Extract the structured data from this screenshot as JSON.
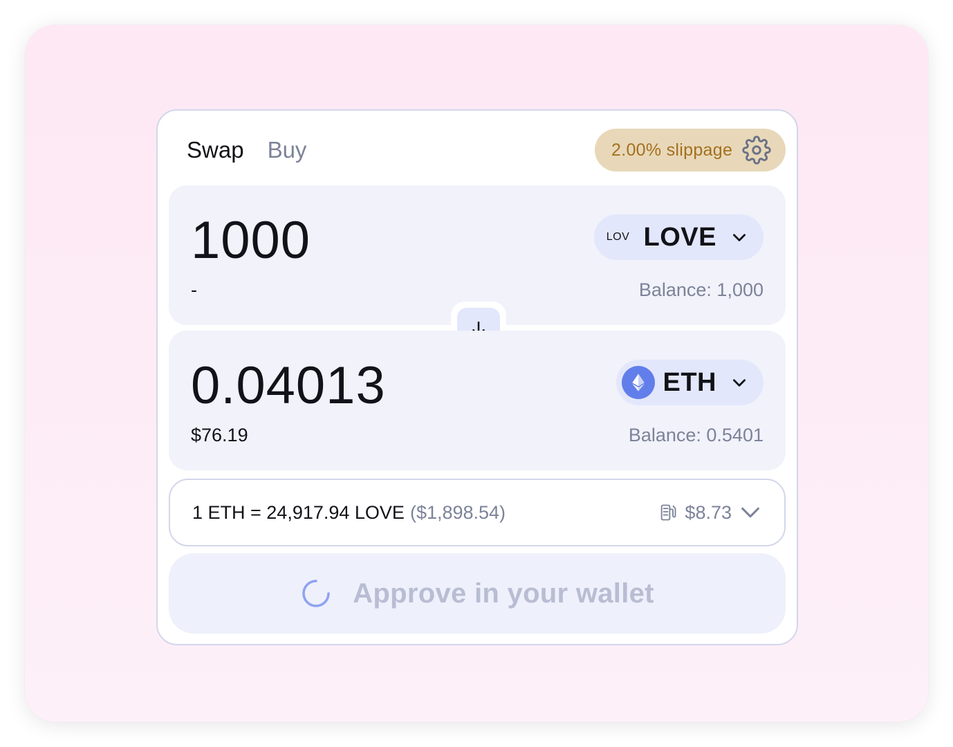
{
  "tabs": [
    {
      "label": "Swap",
      "active": true
    },
    {
      "label": "Buy",
      "active": false
    }
  ],
  "slippage": {
    "label": "2.00% slippage",
    "icon": "gear-icon"
  },
  "input": {
    "amount": "1000",
    "usd_value": "-",
    "token": {
      "badge": "LOV",
      "symbol": "LOVE"
    },
    "balance": "Balance: 1,000"
  },
  "output": {
    "amount": "0.04013",
    "usd_value": "$76.19",
    "token": {
      "symbol": "ETH",
      "icon": "eth-logo-icon"
    },
    "balance": "Balance: 0.5401"
  },
  "rate": {
    "text": "1 ETH = 24,917.94 LOVE",
    "usd": "($1,898.54)",
    "gas_fee": "$8.73",
    "gas_icon": "gas-pump-icon"
  },
  "approve": {
    "label": "Approve in your wallet",
    "icon": "spinner-icon"
  },
  "colors": {
    "background": "#fde8f4",
    "slippage_bg": "#e8d8b9",
    "slippage_text": "#a3701e",
    "panel_bg": "#f1f2fa",
    "token_pill": "#e3e7fb",
    "muted_text": "#7c8399",
    "eth_brand": "#627eea",
    "approve_text": "#b9bdd3"
  }
}
